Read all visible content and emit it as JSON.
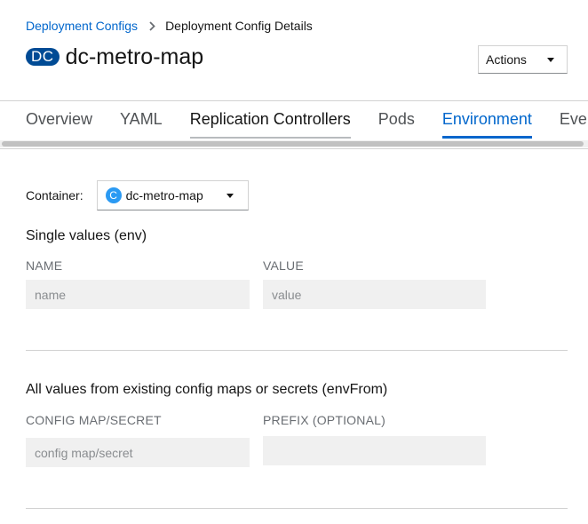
{
  "breadcrumb": {
    "parent": "Deployment Configs",
    "current": "Deployment Config Details"
  },
  "header": {
    "badge": "DC",
    "title": "dc-metro-map",
    "actions_label": "Actions"
  },
  "tabs": [
    {
      "label": "Overview"
    },
    {
      "label": "YAML"
    },
    {
      "label": "Replication Controllers"
    },
    {
      "label": "Pods"
    },
    {
      "label": "Environment"
    },
    {
      "label": "Events"
    }
  ],
  "container": {
    "label": "Container:",
    "icon_letter": "C",
    "selected": "dc-metro-map"
  },
  "single_values": {
    "title": "Single values (env)",
    "name_header": "NAME",
    "value_header": "VALUE",
    "name_placeholder": "name",
    "value_placeholder": "value"
  },
  "env_from": {
    "title": "All values from existing config maps or secrets (envFrom)",
    "configmap_header": "CONFIG MAP/SECRET",
    "prefix_header": "PREFIX (OPTIONAL)",
    "configmap_placeholder": "config map/secret",
    "prefix_value": ""
  },
  "colors": {
    "link": "#0066cc",
    "badge_bg": "#004b95",
    "container_icon": "#2b9af3",
    "field_bg": "#f0f0f0"
  }
}
